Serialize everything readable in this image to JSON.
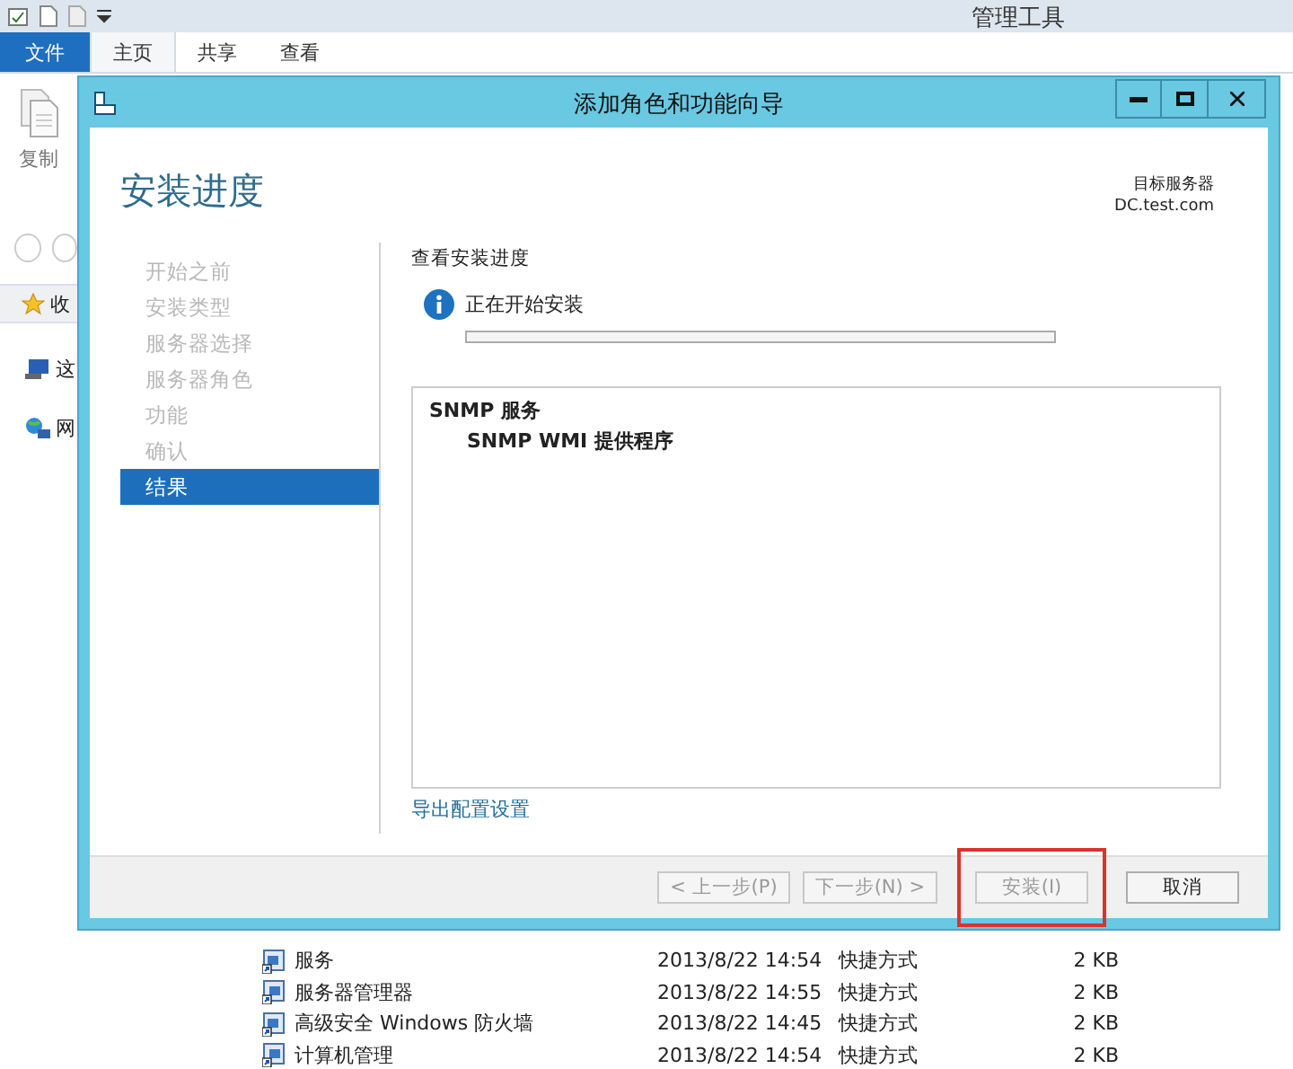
{
  "explorer": {
    "title": "管理工具",
    "ribbon_tabs": [
      {
        "label": "文件",
        "kind": "file",
        "selected": false
      },
      {
        "label": "主页",
        "kind": "tab",
        "selected": true
      },
      {
        "label": "共享",
        "kind": "tab",
        "selected": false
      },
      {
        "label": "查看",
        "kind": "tab",
        "selected": false
      }
    ],
    "copy_label": "复制",
    "nav_items": [
      {
        "label": "收",
        "kind": "star"
      },
      {
        "label": "这",
        "kind": "computer"
      },
      {
        "label": "网",
        "kind": "network"
      }
    ],
    "files": [
      {
        "name": "服务",
        "date": "2013/8/22 14:54",
        "type": "快捷方式",
        "size": "2 KB"
      },
      {
        "name": "服务器管理器",
        "date": "2013/8/22 14:55",
        "type": "快捷方式",
        "size": "2 KB"
      },
      {
        "name": "高级安全 Windows 防火墙",
        "date": "2013/8/22 14:45",
        "type": "快捷方式",
        "size": "2 KB"
      },
      {
        "name": "计算机管理",
        "date": "2013/8/22 14:54",
        "type": "快捷方式",
        "size": "2 KB"
      }
    ]
  },
  "dialog": {
    "title": "添加角色和功能向导",
    "heading": "安装进度",
    "target_label": "目标服务器",
    "target_server": "DC.test.com",
    "steps": [
      {
        "label": "开始之前",
        "selected": false
      },
      {
        "label": "安装类型",
        "selected": false
      },
      {
        "label": "服务器选择",
        "selected": false
      },
      {
        "label": "服务器角色",
        "selected": false
      },
      {
        "label": "功能",
        "selected": false
      },
      {
        "label": "确认",
        "selected": false
      },
      {
        "label": "结果",
        "selected": true
      }
    ],
    "section_title": "查看安装进度",
    "status": "正在开始安装",
    "progress": {
      "level": 0
    },
    "results": [
      {
        "label": "SNMP 服务",
        "children": [
          {
            "label": "SNMP WMI 提供程序"
          }
        ]
      }
    ],
    "export_link": "导出配置设置",
    "buttons": [
      {
        "label": "< 上一步(P)",
        "disabled": true,
        "highlighted": false
      },
      {
        "label": "下一步(N) >",
        "disabled": true,
        "highlighted": false
      },
      {
        "label": "安装(I)",
        "disabled": true,
        "highlighted": true
      },
      {
        "label": "取消",
        "disabled": false,
        "highlighted": false
      }
    ]
  }
}
